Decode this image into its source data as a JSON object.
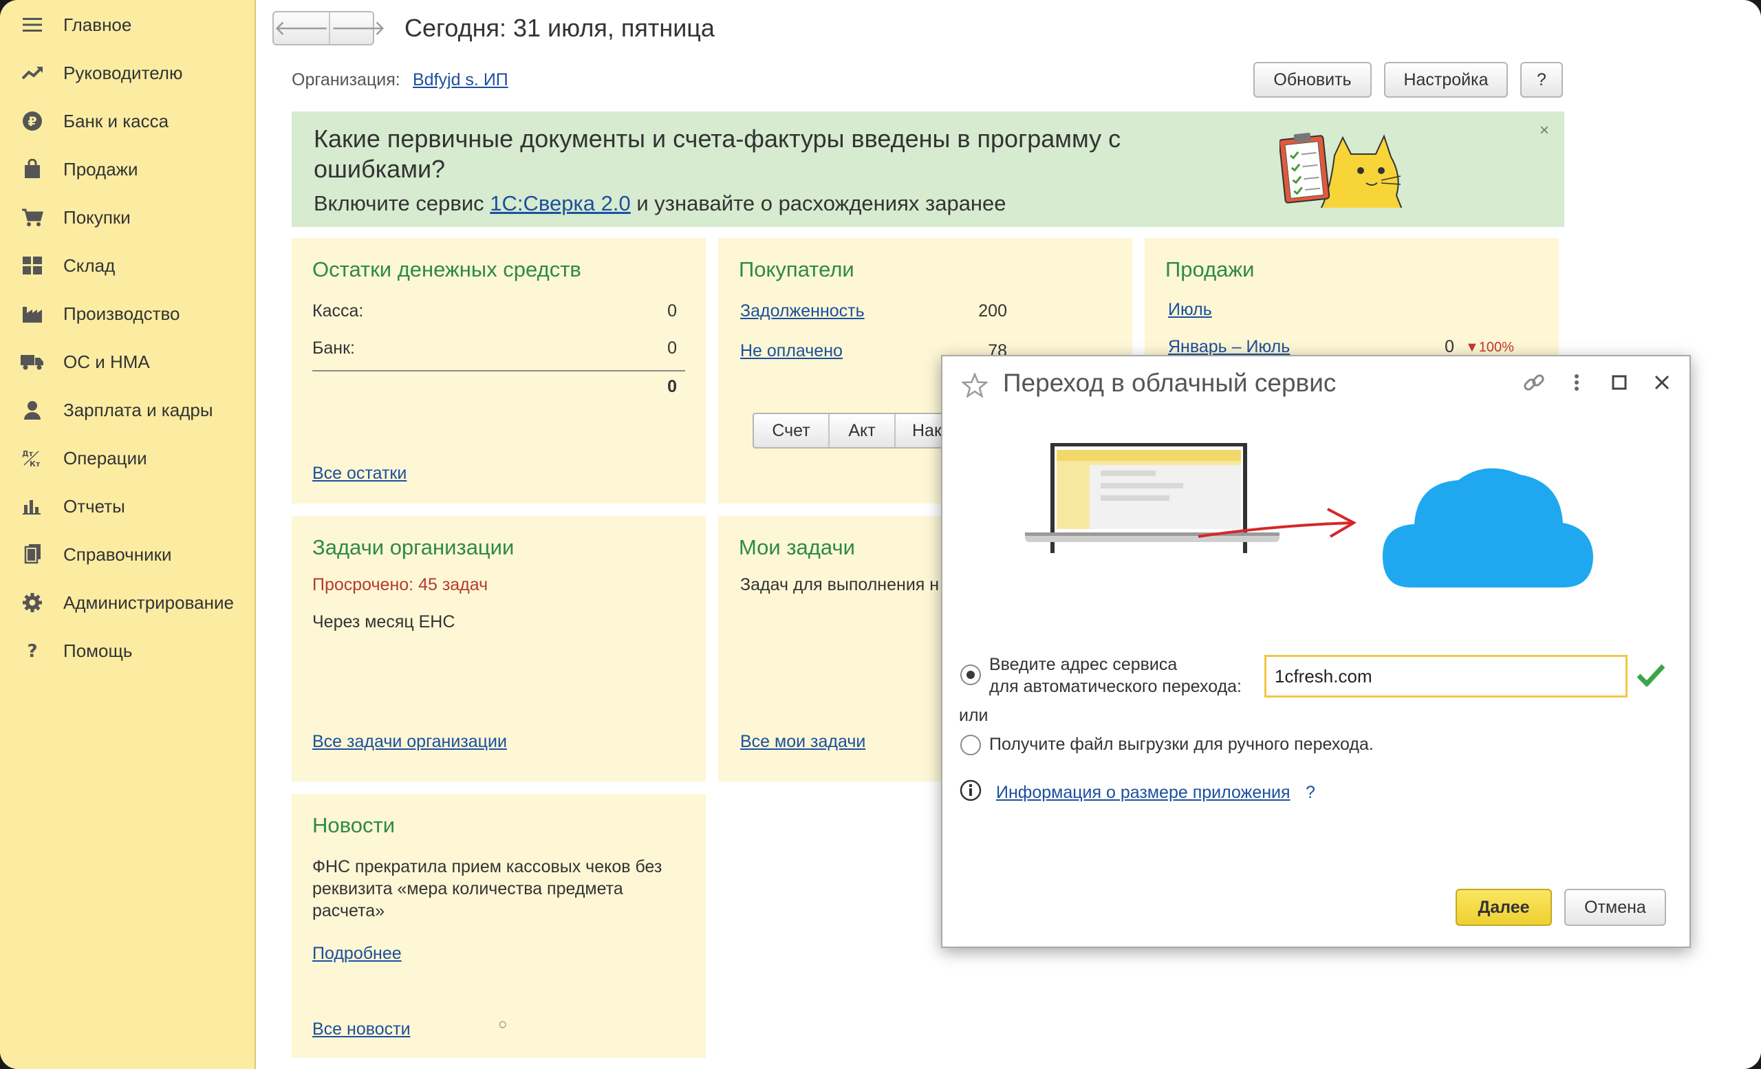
{
  "sidebar": {
    "items": [
      {
        "label": "Главное",
        "icon": "menu-lines-icon"
      },
      {
        "label": "Руководителю",
        "icon": "trend-up-icon"
      },
      {
        "label": "Банк и касса",
        "icon": "ruble-coin-icon"
      },
      {
        "label": "Продажи",
        "icon": "shopping-bag-icon"
      },
      {
        "label": "Покупки",
        "icon": "cart-icon"
      },
      {
        "label": "Склад",
        "icon": "warehouse-grid-icon"
      },
      {
        "label": "Производство",
        "icon": "factory-icon"
      },
      {
        "label": "ОС и НМА",
        "icon": "truck-icon"
      },
      {
        "label": "Зарплата и кадры",
        "icon": "person-icon"
      },
      {
        "label": "Операции",
        "icon": "debit-credit-icon"
      },
      {
        "label": "Отчеты",
        "icon": "bar-chart-icon"
      },
      {
        "label": "Справочники",
        "icon": "books-icon"
      },
      {
        "label": "Администрирование",
        "icon": "gear-icon"
      },
      {
        "label": "Помощь",
        "icon": "question-icon"
      }
    ]
  },
  "header": {
    "back": "🡐",
    "forward": "🡒",
    "today": "Сегодня: 31 июля, пятница",
    "org_label": "Организация:",
    "org_value": "Bdfyjd s. ИП",
    "refresh": "Обновить",
    "settings": "Настройка",
    "help": "?"
  },
  "banner": {
    "title": "Какие первичные документы и счета-фактуры введены в программу с ошибками?",
    "sub_before": "Включите сервис ",
    "sub_link": "1С:Сверка 2.0",
    "sub_after": " и узнавайте о расхождениях заранее",
    "close": "×"
  },
  "cash_card": {
    "title": "Остатки денежных средств",
    "kassa_label": "Касса:",
    "kassa_value": "0",
    "bank_label": "Банк:",
    "bank_value": "0",
    "total": "0",
    "link": "Все остатки"
  },
  "buyers_card": {
    "title": "Покупатели",
    "debt_label": "Задолженность",
    "debt_value": "200",
    "unpaid_label": "Не оплачено",
    "unpaid_value": "78",
    "btn1": "Счет",
    "btn2": "Акт",
    "btn3": "Нак"
  },
  "sales_card": {
    "title": "Продажи",
    "month": "Июль",
    "period": "Январь – Июль",
    "value": "0",
    "change": "▼100%"
  },
  "tasks_org_card": {
    "title": "Задачи организации",
    "overdue": "Просрочено: 45 задач",
    "next": "Через месяц ЕНС",
    "link": "Все задачи организации"
  },
  "my_tasks_card": {
    "title": "Мои задачи",
    "text": "Задач для выполнения н",
    "link": "Все мои задачи"
  },
  "news_card": {
    "title": "Новости",
    "text": "ФНС прекратила прием кассовых чеков без реквизита «мера количества предмета расчета»",
    "more": "Подробнее",
    "all": "Все новости",
    "marker": "○"
  },
  "dialog": {
    "title": "Переход в облачный сервис",
    "option1_line1": "Введите адрес сервиса",
    "option1_line2": "для автоматического перехода:",
    "address_value": "1cfresh.com",
    "or": "или",
    "option2": "Получите файл выгрузки для ручного перехода.",
    "info_link": "Информация о размере приложения",
    "info_help": "?",
    "next": "Далее",
    "cancel": "Отмена"
  },
  "colors": {
    "sidebar_bg": "#fbeca2",
    "card_bg": "#fdf7d5",
    "banner_bg": "#d6ebcf",
    "title_green": "#2f8a43",
    "link_blue": "#1c4f9e",
    "overdue_red": "#b83a2e",
    "cloud_blue": "#1fa8f0",
    "primary_btn": "#f7dc3a"
  }
}
